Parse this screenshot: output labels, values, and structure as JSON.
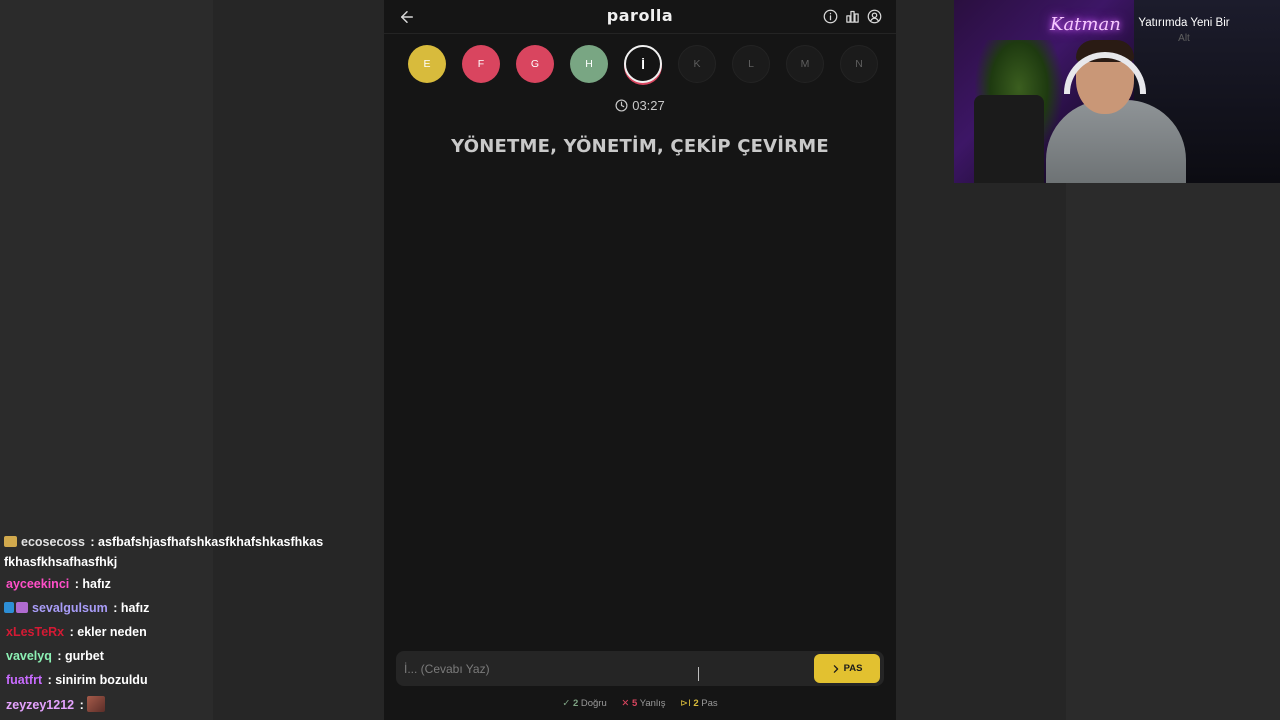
{
  "game": {
    "title": "parolla",
    "letters": [
      {
        "letter": "E",
        "state": "correct"
      },
      {
        "letter": "F",
        "state": "wrong"
      },
      {
        "letter": "G",
        "state": "wrong"
      },
      {
        "letter": "H",
        "state": "pass"
      },
      {
        "letter": "İ",
        "state": "active"
      },
      {
        "letter": "K",
        "state": "pending"
      },
      {
        "letter": "L",
        "state": "pending"
      },
      {
        "letter": "M",
        "state": "pending"
      },
      {
        "letter": "N",
        "state": "pending"
      }
    ],
    "timer": "03:27",
    "question": "YÖNETME, YÖNETİM, ÇEKİP ÇEVİRME",
    "answer": {
      "placeholder": "İ... (Cevabı Yaz)",
      "value": ""
    },
    "pass_button": "PAS",
    "stats": {
      "correct_count": "2",
      "correct_label": "Doğru",
      "wrong_count": "5",
      "wrong_label": "Yanlış",
      "pass_count": "2",
      "pass_label": "Pas"
    },
    "colors": {
      "correct": "#d8bb3c",
      "wrong": "#d9455f",
      "pass": "#79a683",
      "pass_button": "#e2c130"
    }
  },
  "chat": [
    {
      "user": "ecosecoss",
      "color": "#e3e3e3",
      "badges": [
        "camera"
      ],
      "message": "asfbafshjasfhafshkasfkhafshkasfhkasfkhasfkhsafhasfhkj"
    },
    {
      "user": "ayceekinci",
      "color": "#ff4fc8",
      "badges": [],
      "message": "hafız"
    },
    {
      "user": "sevalgulsum",
      "color": "#a89cf7",
      "badges": [
        "cube",
        "gift"
      ],
      "message": "hafız"
    },
    {
      "user": "xLesTeRx",
      "color": "#d41a34",
      "badges": [],
      "message": "ekler neden"
    },
    {
      "user": "vavelyq",
      "color": "#8cf0b4",
      "badges": [],
      "message": "gurbet"
    },
    {
      "user": "fuatfrt",
      "color": "#c86bff",
      "badges": [],
      "message": "sinirim bozuldu"
    },
    {
      "user": "zeyzey1212",
      "color": "#e5a3ff",
      "badges": [],
      "message": ""
    }
  ],
  "webcam": {
    "neon_sign": "Katman",
    "caption": "Yatırımda Yeni Bir",
    "subcaption": "Alt"
  }
}
